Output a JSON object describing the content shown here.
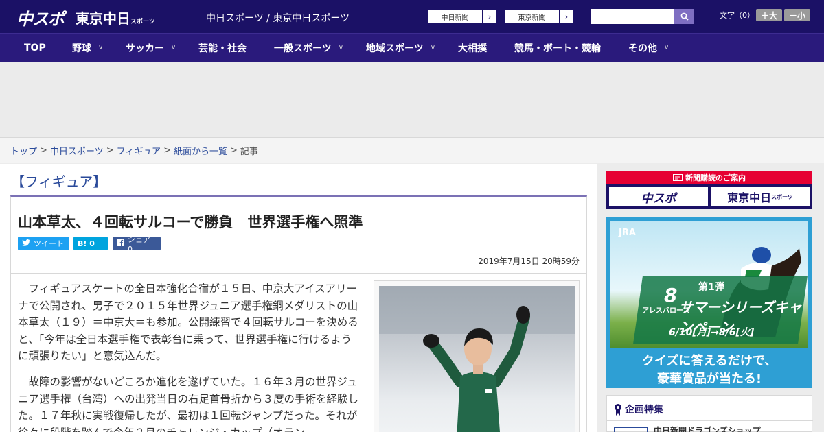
{
  "header": {
    "logo_chuspo": "中スポ",
    "logo_tokyo": "東京中日",
    "logo_tokyo_small": "スポーツ",
    "site_links": "中日スポーツ / 東京中日スポーツ",
    "ext_link_1": "中日新聞",
    "ext_link_2": "東京新聞",
    "arrow": "›",
    "search_placeholder": "",
    "textsize_label": "文字（0）",
    "textsize_plus": "＋大",
    "textsize_minus": "－小"
  },
  "nav": {
    "items": [
      {
        "label": "TOP",
        "has_menu": false
      },
      {
        "label": "野球",
        "has_menu": true
      },
      {
        "label": "サッカー",
        "has_menu": true
      },
      {
        "label": "芸能・社会",
        "has_menu": false
      },
      {
        "label": "一般スポーツ",
        "has_menu": true
      },
      {
        "label": "地域スポーツ",
        "has_menu": true
      },
      {
        "label": "大相撲",
        "has_menu": false
      },
      {
        "label": "競馬・ボート・競輪",
        "has_menu": false
      },
      {
        "label": "その他",
        "has_menu": true
      }
    ],
    "chevron": "∨"
  },
  "breadcrumb": {
    "items": [
      "トップ",
      "中日スポーツ",
      "フィギュア",
      "紙面から一覧"
    ],
    "current": "記事",
    "separator": ">"
  },
  "article": {
    "category": "【フィギュア】",
    "title": "山本草太、４回転サルコーで勝負　世界選手権へ照準",
    "share_twitter": "ツイート",
    "share_hatena": "B! 0",
    "share_facebook": "シェア 0",
    "date": "2019年7月15日 20時59分",
    "paragraphs": [
      "フィギュアスケートの全日本強化合宿が１５日、中京大アイスアリーナで公開され、男子で２０１５年世界ジュニア選手権銅メダリストの山本草太（１９）＝中京大＝も参加。公開練習で４回転サルコーを決めると、「今年は全日本選手権で表彰台に乗って、世界選手権に行けるように頑張りたい」と意気込んだ。",
      "故障の影響がないどころか進化を遂げていた。１６年３月の世界ジュニア選手権（台湾）への出発当日の右足首骨折から３度の手術を経験した。１７年秋に実戦復帰したが、最初は１回転ジャンプだった。それが徐々に段階を踏んで今年２月のチャレンジ・カップ（オラン"
    ]
  },
  "sidebar": {
    "subscribe_bar": "新聞購読のご案内",
    "subscribe_chuspo": "中スポ",
    "subscribe_tokyo": "東京中日",
    "subscribe_tokyo_small": "スポーツ",
    "jra_logo": "JRA",
    "jra_horse_number": "8",
    "jra_horse_name": "アレスバローズ",
    "jra_headline": "サマーシリーズキャンペーン",
    "jra_subline": "6/10[月]→8/6[火]",
    "jra_tag": "第1弾",
    "jra_foot1": "クイズに答えるだけで、",
    "jra_foot2": "豪華賞品が当たる!",
    "feature_title": "企画特集",
    "feature_item": "中日新聞ドラゴンズショップ"
  },
  "colors": {
    "header_bg": "#1b1166",
    "nav_bg": "#2a1a7c",
    "accent_link": "#2a4a9a",
    "twitter": "#1da1f2",
    "hatena": "#00a4de",
    "facebook": "#3b5998",
    "subscribe_red": "#e60033",
    "jra_blue": "#2e9fd4"
  }
}
